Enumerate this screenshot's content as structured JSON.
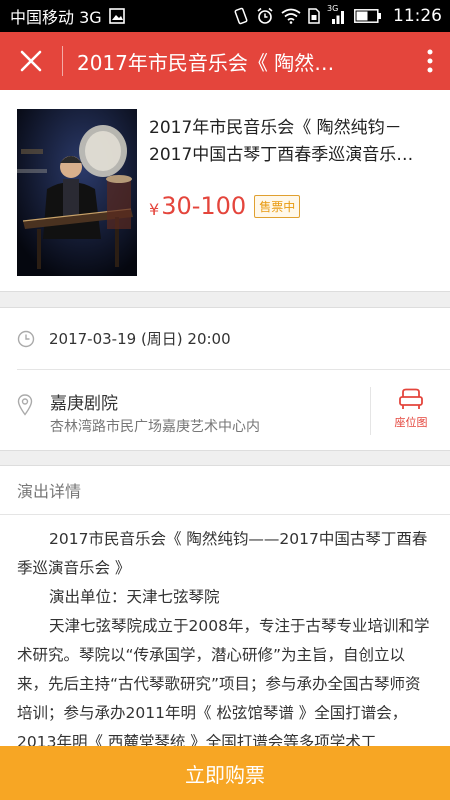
{
  "status_bar": {
    "carrier": "中国移动 3G",
    "net_label": "3G",
    "time": "11:26",
    "icons": [
      "image-icon",
      "vibrate-icon",
      "alarm-icon",
      "wifi-icon",
      "sim-icon",
      "signal-icon",
      "battery-icon"
    ]
  },
  "header": {
    "title": "2017年市民音乐会《 陶然…",
    "title_full": "2017年市民音乐会《 陶然纯钧",
    "close_icon": "close-icon",
    "more_icon": "more-vertical-icon"
  },
  "event": {
    "title": "2017年市民音乐会《 陶然纯钧－2017中国古琴丁酉春季巡演音乐…",
    "price_symbol": "¥",
    "price": "30-100",
    "status_badge": "售票中"
  },
  "info": {
    "datetime": "2017-03-19 (周日) 20:00",
    "venue_name": "嘉庚剧院",
    "venue_address": "杏林湾路市民广场嘉庚艺术中心内",
    "seat_map_label": "座位图"
  },
  "details": {
    "heading": "演出详情",
    "paragraphs": [
      "2017市民音乐会《 陶然纯钧——2017中国古琴丁酉春季巡演音乐会 》",
      "演出单位：天津七弦琴院",
      "天津七弦琴院成立于2008年，专注于古琴专业培训和学术研究。琴院以“传承国学，潜心研修”为主旨，自创立以来，先后主持“古代琴歌研究”项目；参与承办全国古琴师资培训；参与承办2011年明《 松弦馆琴谱 》全国打谱会，2013年明《 西麓堂琴统 》全国打谱会等多项学术工"
    ]
  },
  "buy_button": "立即购票",
  "colors": {
    "header_red": "#e4453c",
    "price_red": "#e4453c",
    "buy_orange": "#f7a624",
    "badge_orange": "#e89a10"
  }
}
